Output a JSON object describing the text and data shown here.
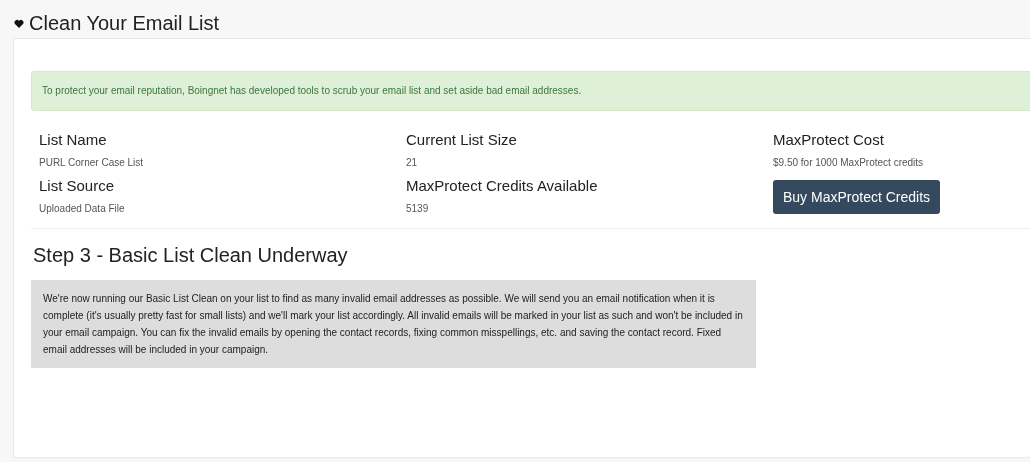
{
  "page_title": "Clean Your Email List",
  "alert": "To protect your email reputation, Boingnet has developed tools to scrub your email list and set aside bad email addresses.",
  "fields": [
    {
      "label": "List Name",
      "value": "PURL Corner Case List"
    },
    {
      "label": "Current List Size",
      "value": "21"
    },
    {
      "label": "MaxProtect Cost",
      "value": "$9.50 for 1000 MaxProtect credits"
    },
    {
      "label": "List Source",
      "value": "Uploaded Data File"
    },
    {
      "label": "MaxProtect Credits Available",
      "value": "5139"
    }
  ],
  "buy_button": "Buy MaxProtect Credits",
  "step": {
    "title": "Step 3 - Basic List Clean Underway",
    "message": "We're now running our Basic List Clean on your list to find as many invalid email addresses as possible. We will send you an email notification when it is complete (it's usually pretty fast for small lists) and we'll mark your list accordingly. All invalid emails will be marked in your list as such and won't be included in your email campaign. You can fix the invalid emails by opening the contact records, fixing common misspellings, etc. and saving the contact record. Fixed email addresses will be included in your campaign."
  }
}
